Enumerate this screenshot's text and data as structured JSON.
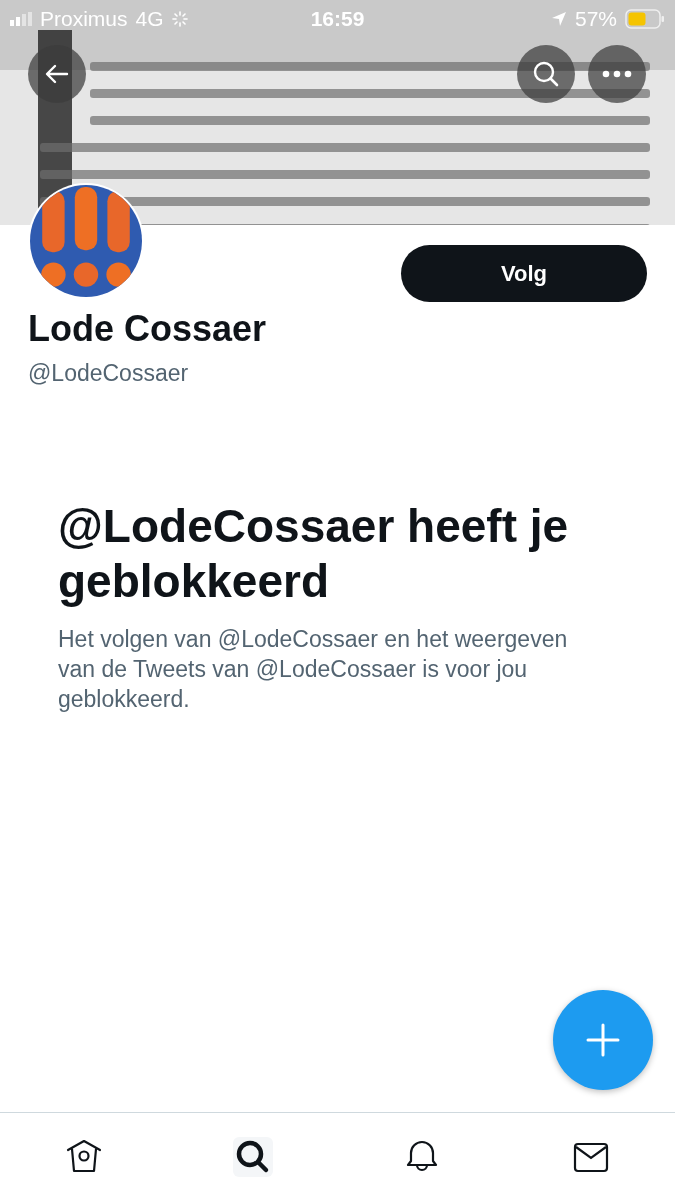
{
  "status_bar": {
    "carrier": "Proximus",
    "network": "4G",
    "time": "16:59",
    "battery": "57%"
  },
  "profile": {
    "follow_button": "Volg",
    "name": "Lode Cossaer",
    "handle": "@LodeCossaer"
  },
  "blocked": {
    "title": "@LodeCossaer heeft je geblokkeerd",
    "message": "Het volgen van @LodeCossaer en het weergeven van de Tweets van @LodeCossaer is voor jou geblokkeerd."
  },
  "nav": [
    {
      "kind": "home",
      "selected": false
    },
    {
      "kind": "search",
      "selected": true
    },
    {
      "kind": "notifications",
      "selected": false
    },
    {
      "kind": "messages",
      "selected": false
    }
  ]
}
